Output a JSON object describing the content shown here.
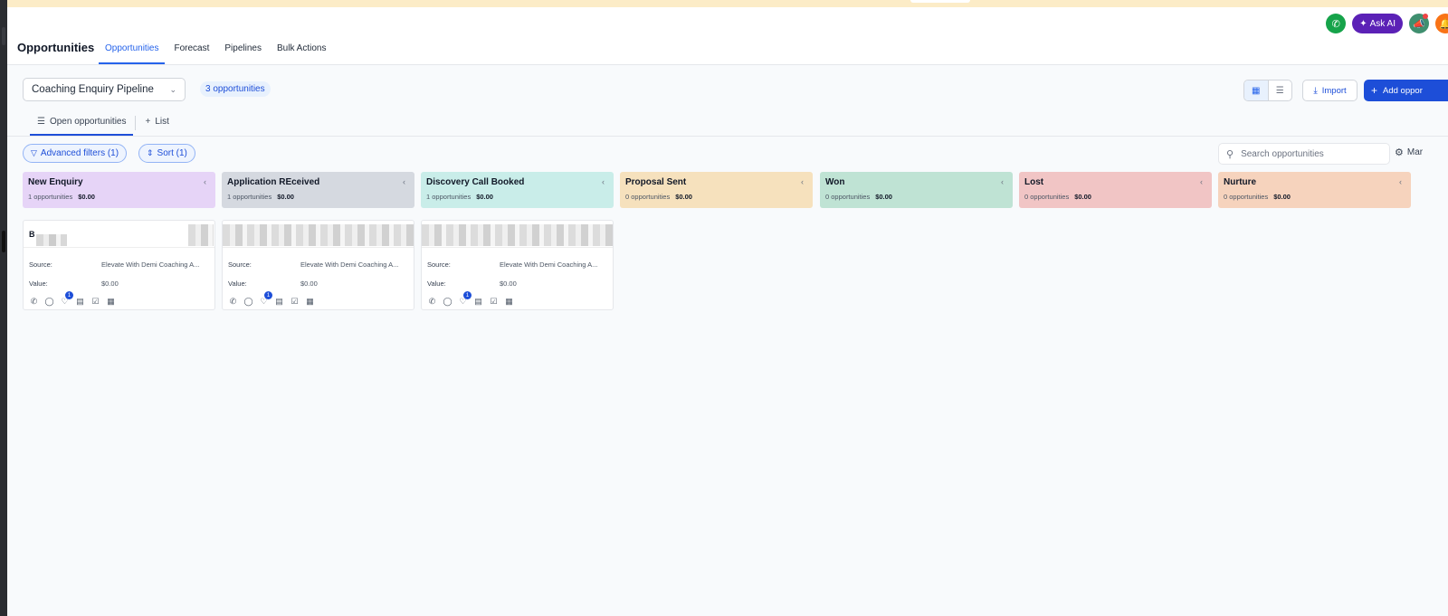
{
  "header": {
    "page_title": "Opportunities",
    "tabs": [
      {
        "label": "Opportunities",
        "active": true
      },
      {
        "label": "Forecast",
        "active": false
      },
      {
        "label": "Pipelines",
        "active": false
      },
      {
        "label": "Bulk Actions",
        "active": false
      }
    ],
    "ask_ai_label": "Ask AI"
  },
  "toolbar": {
    "pipeline_name": "Coaching Enquiry Pipeline",
    "opportunity_count": "3 opportunities",
    "import_label": "Import",
    "add_label": "Add oppor"
  },
  "subtabs": [
    {
      "label": "Open opportunities",
      "icon": "list-icon",
      "active": true
    },
    {
      "label": "List",
      "icon": "plus-icon",
      "active": false
    }
  ],
  "filters": {
    "advanced_label": "Advanced filters (1)",
    "sort_label": "Sort (1)",
    "search_placeholder": "Search opportunities",
    "manage_label": "Mar"
  },
  "columns": [
    {
      "name": "New Enquiry",
      "count": "1 opportunities",
      "amount": "$0.00",
      "color": "#e6d4f7",
      "cards": [
        {
          "name_initial": "B",
          "source_label": "Source:",
          "source": "Elevate With Demi Coaching A...",
          "value_label": "Value:",
          "value": "$0.00",
          "task_badge": "1"
        }
      ]
    },
    {
      "name": "Application REceived",
      "count": "1 opportunities",
      "amount": "$0.00",
      "color": "#d5d9e0",
      "cards": [
        {
          "name_initial": "",
          "source_label": "Source:",
          "source": "Elevate With Demi Coaching A...",
          "value_label": "Value:",
          "value": "$0.00",
          "task_badge": "1"
        }
      ]
    },
    {
      "name": "Discovery Call Booked",
      "count": "1 opportunities",
      "amount": "$0.00",
      "color": "#c9ede9",
      "cards": [
        {
          "name_initial": "",
          "source_label": "Source:",
          "source": "Elevate With Demi Coaching A...",
          "value_label": "Value:",
          "value": "$0.00",
          "task_badge": "1"
        }
      ]
    },
    {
      "name": "Proposal Sent",
      "count": "0 opportunities",
      "amount": "$0.00",
      "color": "#f6e1bd",
      "cards": []
    },
    {
      "name": "Won",
      "count": "0 opportunities",
      "amount": "$0.00",
      "color": "#bfe3d4",
      "cards": []
    },
    {
      "name": "Lost",
      "count": "0 opportunities",
      "amount": "$0.00",
      "color": "#f1c5c5",
      "cards": []
    },
    {
      "name": "Nurture",
      "count": "0 opportunities",
      "amount": "$0.00",
      "color": "#f6d3bd",
      "cards": []
    }
  ]
}
